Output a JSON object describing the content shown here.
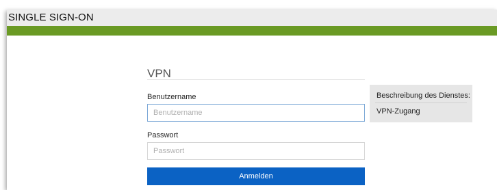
{
  "header": {
    "title": "SINGLE SIGN-ON",
    "accent_color": "#6a9a24"
  },
  "login": {
    "section_title": "VPN",
    "username_label": "Benutzername",
    "username_placeholder": "Benutzername",
    "username_value": "",
    "password_label": "Passwort",
    "password_placeholder": "Passwort",
    "password_value": "",
    "submit_label": "Anmelden",
    "submit_color": "#0b62c4"
  },
  "service": {
    "description_label": "Beschreibung des Dienstes:",
    "description_value": "VPN-Zugang"
  }
}
